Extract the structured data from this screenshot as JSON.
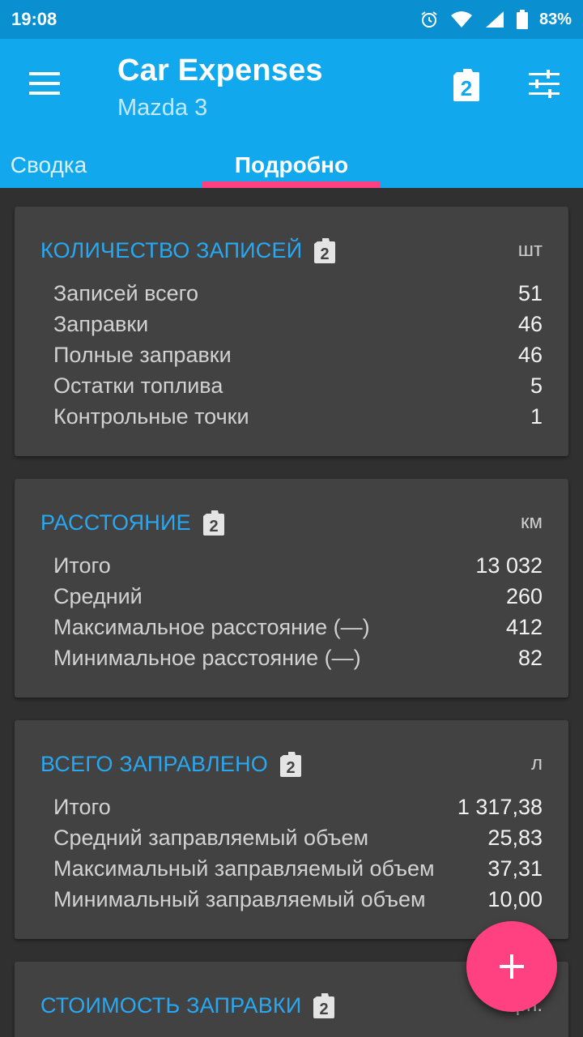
{
  "status_bar": {
    "time": "19:08",
    "battery": "83%"
  },
  "app_bar": {
    "title": "Car Expenses",
    "subtitle": "Mazda 3",
    "fuel_icon_number": "2",
    "tabs": [
      {
        "label": "Сводка",
        "selected": false
      },
      {
        "label": "Подробно",
        "selected": true
      }
    ]
  },
  "colors": {
    "appbar": "#12a8ee",
    "statusbar": "#0a8fd0",
    "accent": "#ff4081",
    "card_title": "#29a8f2",
    "background": "#303030",
    "card": "#424242"
  },
  "cards": [
    {
      "title": "КОЛИЧЕСТВО ЗАПИСЕЙ",
      "icon_number": "2",
      "unit": "шт",
      "rows": [
        {
          "label": "Записей всего",
          "value": "51"
        },
        {
          "label": "Заправки",
          "value": "46"
        },
        {
          "label": "Полные заправки",
          "value": "46"
        },
        {
          "label": "Остатки топлива",
          "value": "5"
        },
        {
          "label": "Контрольные точки",
          "value": "1"
        }
      ]
    },
    {
      "title": "РАССТОЯНИЕ",
      "icon_number": "2",
      "unit": "км",
      "rows": [
        {
          "label": "Итого",
          "value": "13 032"
        },
        {
          "label": "Средний",
          "value": "260"
        },
        {
          "label": "Максимальное расстояние (—)",
          "value": "412"
        },
        {
          "label": "Минимальное расстояние (—)",
          "value": "82"
        }
      ]
    },
    {
      "title": "ВСЕГО ЗАПРАВЛЕНО",
      "icon_number": "2",
      "unit": "л",
      "rows": [
        {
          "label": "Итого",
          "value": "1 317,38"
        },
        {
          "label": "Средний заправляемый объем",
          "value": "25,83"
        },
        {
          "label": "Максимальный заправляемый объем",
          "value": "37,31"
        },
        {
          "label": "Минимальный заправляемый объем",
          "value": "10,00"
        }
      ]
    },
    {
      "title": "СТОИМОСТЬ ЗАПРАВКИ",
      "icon_number": "2",
      "unit": "грн."
    }
  ],
  "fab": {
    "icon": "plus-icon"
  }
}
